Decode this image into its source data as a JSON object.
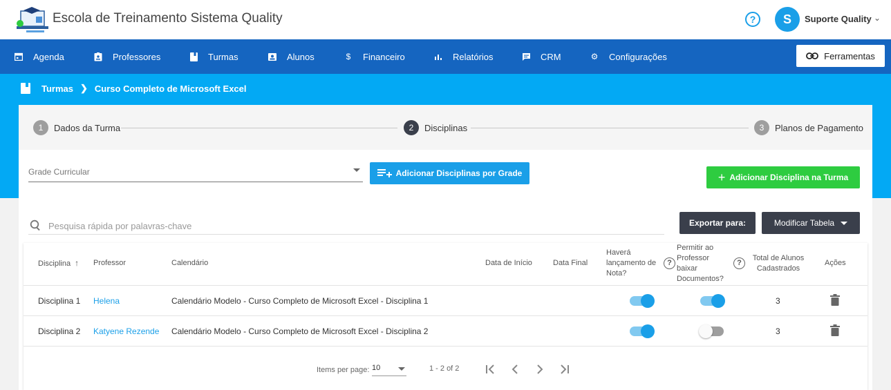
{
  "header": {
    "app_title": "Escola de Treinamento Sistema Quality",
    "help_icon": "help-circle-icon",
    "avatar_letter": "S",
    "user_name": "Suporte Quality"
  },
  "nav": {
    "items": [
      {
        "label": "Agenda",
        "icon": "calendar-icon"
      },
      {
        "label": "Professores",
        "icon": "badge-icon"
      },
      {
        "label": "Turmas",
        "icon": "book-icon"
      },
      {
        "label": "Alunos",
        "icon": "contacts-icon"
      },
      {
        "label": "Financeiro",
        "icon": "dollar-icon"
      },
      {
        "label": "Relatórios",
        "icon": "bar-chart-icon"
      },
      {
        "label": "CRM",
        "icon": "chat-icon"
      },
      {
        "label": "Configurações",
        "icon": "gear-icon"
      }
    ],
    "tools_label": "Ferramentas"
  },
  "breadcrumb": {
    "root": "Turmas",
    "current": "Curso Completo de Microsoft Excel"
  },
  "stepper": {
    "steps": [
      {
        "num": "1",
        "label": "Dados da Turma"
      },
      {
        "num": "2",
        "label": "Disciplinas"
      },
      {
        "num": "3",
        "label": "Planos de Pagamento"
      }
    ],
    "active_step": 2
  },
  "form": {
    "grade_placeholder": "Grade Curricular",
    "add_by_grade_label": "Adicionar Disciplinas por Grade",
    "add_discipline_label": "Adicionar Disciplina na Turma",
    "search_placeholder": "Pesquisa rápida por palavras-chave",
    "export_label": "Exportar para:",
    "modify_table_label": "Modificar Tabela"
  },
  "table": {
    "headers": {
      "disciplina": "Disciplina",
      "professor": "Professor",
      "calendario": "Calendário",
      "data_inicio": "Data de Início",
      "data_final": "Data Final",
      "nota": [
        "Haverá",
        "lançamento de",
        "Nota?"
      ],
      "documentos": [
        "Permitir ao",
        "Professor",
        "baixar",
        "Documentos?"
      ],
      "total_alunos": [
        "Total de Alunos",
        "Cadastrados"
      ],
      "acoes": "Ações"
    },
    "sort_indicator": "↑",
    "rows": [
      {
        "disciplina": "Disciplina 1",
        "professor": "Helena",
        "calendario": "Calendário Modelo - Curso Completo de Microsoft Excel - Disciplina 1",
        "nota": true,
        "documentos": true,
        "total": "3"
      },
      {
        "disciplina": "Disciplina 2",
        "professor": "Katyene Rezende",
        "calendario": "Calendário Modelo - Curso Completo de Microsoft Excel - Disciplina 2",
        "nota": true,
        "documentos": false,
        "total": "3"
      }
    ]
  },
  "pagination": {
    "items_per_page_label": "Items per page:",
    "items_per_page_value": "10",
    "range": "1 - 2 of 2"
  },
  "colors": {
    "nav_blue": "#1565c0",
    "band_blue": "#03a9f4",
    "accent": "#1a9fe8",
    "green": "#2ecc40",
    "dark_button": "#3a3f4b"
  }
}
